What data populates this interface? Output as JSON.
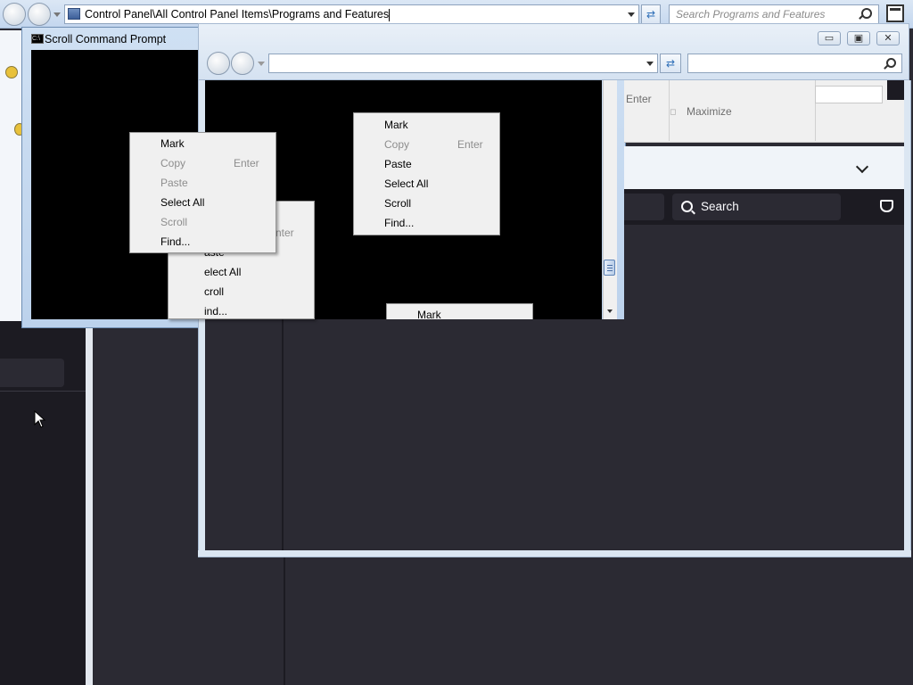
{
  "explorer": {
    "address": "Control Panel\\All Control Panel Items\\Programs and Features",
    "search_placeholder": "Search Programs and Features"
  },
  "cmd_window": {
    "title": "Scroll Command Prompt",
    "icon_text": "C:\\"
  },
  "context_menu": {
    "items": [
      {
        "label": "Mark",
        "enabled": true
      },
      {
        "label": "Copy",
        "shortcut": "Enter",
        "enabled": false
      },
      {
        "label": "Paste",
        "enabled": false
      },
      {
        "label": "Select All",
        "enabled": true
      },
      {
        "label": "Scroll",
        "enabled": false
      },
      {
        "label": "Find...",
        "enabled": true
      }
    ]
  },
  "context_menu_2": {
    "items": [
      {
        "label": "Mark",
        "enabled": true
      },
      {
        "label": "Copy",
        "shortcut": "Enter",
        "enabled": false
      },
      {
        "label": "Paste",
        "enabled": true
      },
      {
        "label": "Select All",
        "enabled": true
      },
      {
        "label": "Scroll",
        "enabled": true
      },
      {
        "label": "Find...",
        "enabled": true
      }
    ]
  },
  "context_menu_partial": {
    "shortcut": "nter",
    "items": [
      "aste",
      "elect All",
      "croll",
      "ind..."
    ]
  },
  "context_menu_bottom": {
    "first": "Mark"
  },
  "system_menu_fragment": {
    "shortcut": "Enter",
    "maximize": "Maximize"
  },
  "dark_app": {
    "search_label": "Search"
  },
  "icons": [
    "back-icon",
    "forward-icon",
    "refresh-icon",
    "search-icon",
    "dropdown-icon",
    "cmd-icon",
    "minimize-icon",
    "restore-icon",
    "close-icon",
    "chevron-down-icon",
    "pocket-icon",
    "mouse-cursor-icon"
  ]
}
